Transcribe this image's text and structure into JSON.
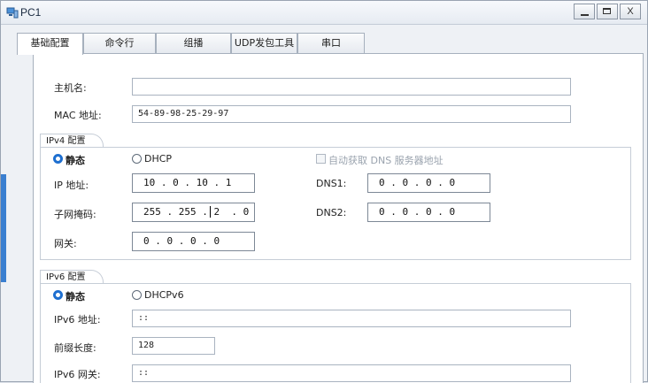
{
  "window": {
    "title": "PC1",
    "min_label": "",
    "max_label": "",
    "close_label": "X"
  },
  "tabs": [
    "基础配置",
    "命令行",
    "组播",
    "UDP发包工具",
    "串口"
  ],
  "basic": {
    "hostname_label": "主机名:",
    "hostname_value": "",
    "mac_label": "MAC 地址:",
    "mac_value": "54-89-98-25-29-97"
  },
  "ipv4": {
    "group_label": "IPv4 配置",
    "static_label": "静态",
    "dhcp_label": "DHCP",
    "auto_dns_label": "自动获取 DNS 服务器地址",
    "ip_label": "IP 地址:",
    "ip_value": "10 . 0 . 10 . 1",
    "mask_label": "子网掩码:",
    "mask_value": "255 . 255 . 2  . 0",
    "gateway_label": "网关:",
    "gateway_value": "0 . 0 . 0 . 0",
    "dns1_label": "DNS1:",
    "dns1_value": "0 . 0 . 0 . 0",
    "dns2_label": "DNS2:",
    "dns2_value": "0 . 0 . 0 . 0",
    "mode_selected": "静态"
  },
  "ipv6": {
    "group_label": "IPv6 配置",
    "static_label": "静态",
    "dhcp_label": "DHCPv6",
    "addr_label": "IPv6 地址:",
    "addr_value": "::",
    "prefix_label": "前缀长度:",
    "prefix_value": "128",
    "gateway_label": "IPv6 网关:",
    "gateway_value": "::",
    "mode_selected": "静态"
  },
  "colors": {
    "accent": "#1e6fd0",
    "title_text": "#1a2a40"
  }
}
